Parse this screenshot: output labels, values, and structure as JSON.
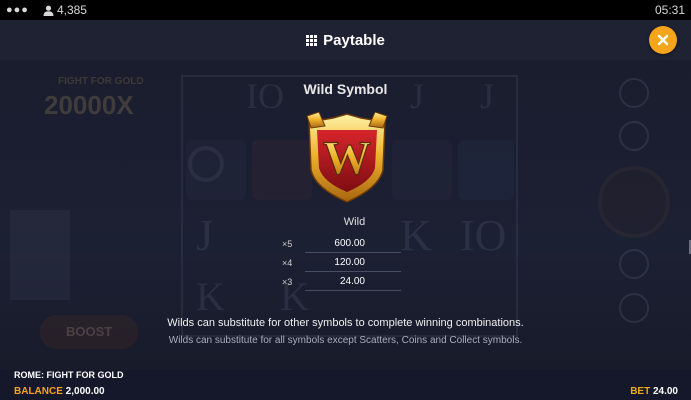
{
  "status_bar": {
    "menu_dots": "●●●",
    "players_count": "4,385",
    "time": "05:31"
  },
  "header": {
    "title": "Paytable",
    "close_icon": "close-icon"
  },
  "background": {
    "jackpot_label": "FIGHT FOR GOLD",
    "jackpot_value": "20000X",
    "boost_label": "BOOST"
  },
  "symbol": {
    "heading": "Wild Symbol",
    "name": "Wild",
    "payouts": [
      {
        "mult": "×5",
        "amount": "600.00"
      },
      {
        "mult": "×4",
        "amount": "120.00"
      },
      {
        "mult": "×3",
        "amount": "24.00"
      }
    ],
    "emblem_letter": "W"
  },
  "rules": {
    "line1": "Wilds can substitute for other symbols to complete winning combinations.",
    "line2": "Wilds can substitute for all symbols except Scatters, Coins and Collect symbols."
  },
  "footer": {
    "game_name": "ROME: FIGHT FOR GOLD",
    "balance_label": "BALANCE",
    "balance_value": "2,000.00",
    "bet_label": "BET",
    "bet_value": "24.00"
  },
  "colors": {
    "accent": "#f4a51c",
    "background": "#1c2033",
    "header": "#1e2233"
  }
}
